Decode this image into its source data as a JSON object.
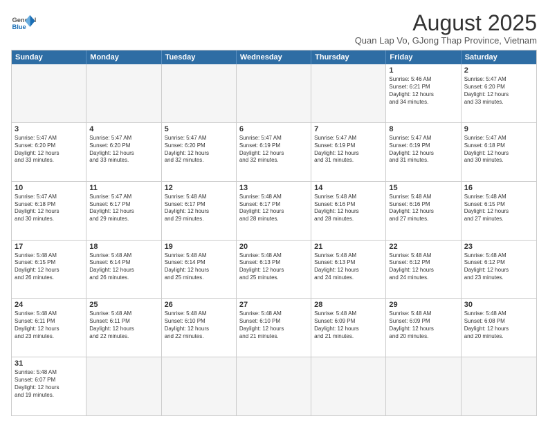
{
  "header": {
    "logo_line1": "General",
    "logo_line2": "Blue",
    "month_title": "August 2025",
    "location": "Quan Lap Vo, GJong Thap Province, Vietnam"
  },
  "days_of_week": [
    "Sunday",
    "Monday",
    "Tuesday",
    "Wednesday",
    "Thursday",
    "Friday",
    "Saturday"
  ],
  "weeks": [
    [
      {
        "day": "",
        "info": ""
      },
      {
        "day": "",
        "info": ""
      },
      {
        "day": "",
        "info": ""
      },
      {
        "day": "",
        "info": ""
      },
      {
        "day": "",
        "info": ""
      },
      {
        "day": "1",
        "info": "Sunrise: 5:46 AM\nSunset: 6:21 PM\nDaylight: 12 hours\nand 34 minutes."
      },
      {
        "day": "2",
        "info": "Sunrise: 5:47 AM\nSunset: 6:20 PM\nDaylight: 12 hours\nand 33 minutes."
      }
    ],
    [
      {
        "day": "3",
        "info": "Sunrise: 5:47 AM\nSunset: 6:20 PM\nDaylight: 12 hours\nand 33 minutes."
      },
      {
        "day": "4",
        "info": "Sunrise: 5:47 AM\nSunset: 6:20 PM\nDaylight: 12 hours\nand 33 minutes."
      },
      {
        "day": "5",
        "info": "Sunrise: 5:47 AM\nSunset: 6:20 PM\nDaylight: 12 hours\nand 32 minutes."
      },
      {
        "day": "6",
        "info": "Sunrise: 5:47 AM\nSunset: 6:19 PM\nDaylight: 12 hours\nand 32 minutes."
      },
      {
        "day": "7",
        "info": "Sunrise: 5:47 AM\nSunset: 6:19 PM\nDaylight: 12 hours\nand 31 minutes."
      },
      {
        "day": "8",
        "info": "Sunrise: 5:47 AM\nSunset: 6:19 PM\nDaylight: 12 hours\nand 31 minutes."
      },
      {
        "day": "9",
        "info": "Sunrise: 5:47 AM\nSunset: 6:18 PM\nDaylight: 12 hours\nand 30 minutes."
      }
    ],
    [
      {
        "day": "10",
        "info": "Sunrise: 5:47 AM\nSunset: 6:18 PM\nDaylight: 12 hours\nand 30 minutes."
      },
      {
        "day": "11",
        "info": "Sunrise: 5:47 AM\nSunset: 6:17 PM\nDaylight: 12 hours\nand 29 minutes."
      },
      {
        "day": "12",
        "info": "Sunrise: 5:48 AM\nSunset: 6:17 PM\nDaylight: 12 hours\nand 29 minutes."
      },
      {
        "day": "13",
        "info": "Sunrise: 5:48 AM\nSunset: 6:17 PM\nDaylight: 12 hours\nand 28 minutes."
      },
      {
        "day": "14",
        "info": "Sunrise: 5:48 AM\nSunset: 6:16 PM\nDaylight: 12 hours\nand 28 minutes."
      },
      {
        "day": "15",
        "info": "Sunrise: 5:48 AM\nSunset: 6:16 PM\nDaylight: 12 hours\nand 27 minutes."
      },
      {
        "day": "16",
        "info": "Sunrise: 5:48 AM\nSunset: 6:15 PM\nDaylight: 12 hours\nand 27 minutes."
      }
    ],
    [
      {
        "day": "17",
        "info": "Sunrise: 5:48 AM\nSunset: 6:15 PM\nDaylight: 12 hours\nand 26 minutes."
      },
      {
        "day": "18",
        "info": "Sunrise: 5:48 AM\nSunset: 6:14 PM\nDaylight: 12 hours\nand 26 minutes."
      },
      {
        "day": "19",
        "info": "Sunrise: 5:48 AM\nSunset: 6:14 PM\nDaylight: 12 hours\nand 25 minutes."
      },
      {
        "day": "20",
        "info": "Sunrise: 5:48 AM\nSunset: 6:13 PM\nDaylight: 12 hours\nand 25 minutes."
      },
      {
        "day": "21",
        "info": "Sunrise: 5:48 AM\nSunset: 6:13 PM\nDaylight: 12 hours\nand 24 minutes."
      },
      {
        "day": "22",
        "info": "Sunrise: 5:48 AM\nSunset: 6:12 PM\nDaylight: 12 hours\nand 24 minutes."
      },
      {
        "day": "23",
        "info": "Sunrise: 5:48 AM\nSunset: 6:12 PM\nDaylight: 12 hours\nand 23 minutes."
      }
    ],
    [
      {
        "day": "24",
        "info": "Sunrise: 5:48 AM\nSunset: 6:11 PM\nDaylight: 12 hours\nand 23 minutes."
      },
      {
        "day": "25",
        "info": "Sunrise: 5:48 AM\nSunset: 6:11 PM\nDaylight: 12 hours\nand 22 minutes."
      },
      {
        "day": "26",
        "info": "Sunrise: 5:48 AM\nSunset: 6:10 PM\nDaylight: 12 hours\nand 22 minutes."
      },
      {
        "day": "27",
        "info": "Sunrise: 5:48 AM\nSunset: 6:10 PM\nDaylight: 12 hours\nand 21 minutes."
      },
      {
        "day": "28",
        "info": "Sunrise: 5:48 AM\nSunset: 6:09 PM\nDaylight: 12 hours\nand 21 minutes."
      },
      {
        "day": "29",
        "info": "Sunrise: 5:48 AM\nSunset: 6:09 PM\nDaylight: 12 hours\nand 20 minutes."
      },
      {
        "day": "30",
        "info": "Sunrise: 5:48 AM\nSunset: 6:08 PM\nDaylight: 12 hours\nand 20 minutes."
      }
    ],
    [
      {
        "day": "31",
        "info": "Sunrise: 5:48 AM\nSunset: 6:07 PM\nDaylight: 12 hours\nand 19 minutes."
      },
      {
        "day": "",
        "info": ""
      },
      {
        "day": "",
        "info": ""
      },
      {
        "day": "",
        "info": ""
      },
      {
        "day": "",
        "info": ""
      },
      {
        "day": "",
        "info": ""
      },
      {
        "day": "",
        "info": ""
      }
    ]
  ]
}
